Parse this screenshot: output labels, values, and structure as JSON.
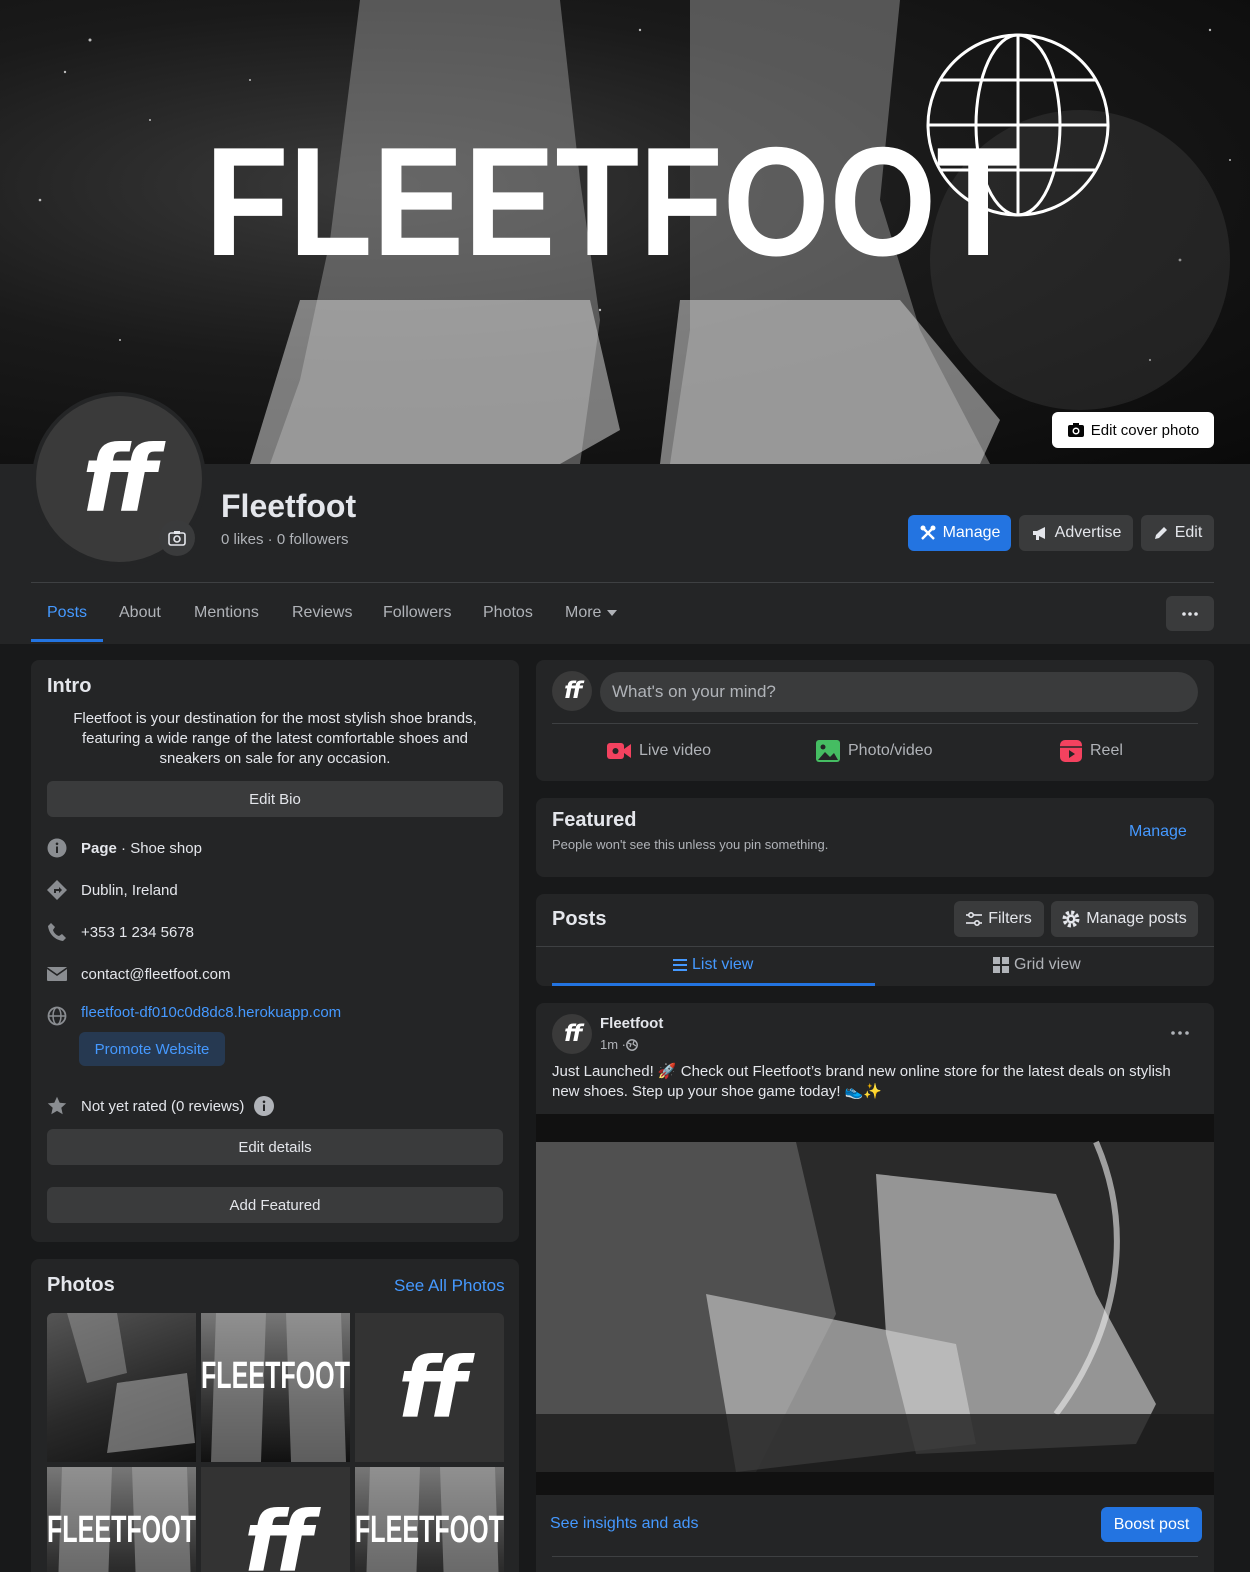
{
  "cover": {
    "brand_text": "FLEETFOOT",
    "edit_cover_label": "Edit cover photo"
  },
  "profile": {
    "name": "Fleetfoot",
    "stats": "0 likes · 0 followers",
    "avatar_text": "ff",
    "manage_label": "Manage",
    "advertise_label": "Advertise",
    "edit_label": "Edit"
  },
  "tabs": [
    "Posts",
    "About",
    "Mentions",
    "Reviews",
    "Followers",
    "Photos",
    "More"
  ],
  "intro": {
    "title": "Intro",
    "bio": "Fleetfoot is your destination for the most stylish shoe brands, featuring a wide range of the latest comfortable shoes and sneakers on sale for any occasion.",
    "edit_bio_label": "Edit Bio",
    "page_label": "Page",
    "page_category": " · Shoe shop",
    "location": "Dublin, Ireland",
    "phone": "+353 1 234 5678",
    "email": "contact@fleetfoot.com",
    "website": "fleetfoot-df010c0d8dc8.herokuapp.com",
    "promote_label": "Promote Website",
    "rating": "Not yet rated (0 reviews)",
    "edit_details_label": "Edit details",
    "add_featured_label": "Add Featured"
  },
  "photos": {
    "title": "Photos",
    "see_all_label": "See All Photos"
  },
  "composer": {
    "placeholder": "What's on your mind?",
    "live_label": "Live video",
    "photo_label": "Photo/video",
    "reel_label": "Reel"
  },
  "featured": {
    "title": "Featured",
    "subtitle": "People won't see this unless you pin something.",
    "manage_label": "Manage"
  },
  "posts_header": {
    "title": "Posts",
    "filters_label": "Filters",
    "manage_posts_label": "Manage posts",
    "list_view_label": "List view",
    "grid_view_label": "Grid view"
  },
  "post": {
    "author": "Fleetfoot",
    "time": "1m · ",
    "text": "Just Launched! 🚀 Check out Fleetfoot’s brand new online store for the latest deals on stylish new shoes. Step up your shoe game today! 👟✨",
    "insights_label": "See insights and ads",
    "boost_label": "Boost post"
  },
  "colors": {
    "accent": "#2374e1",
    "link": "#4599ff",
    "card": "#242526",
    "background": "#18191a"
  }
}
